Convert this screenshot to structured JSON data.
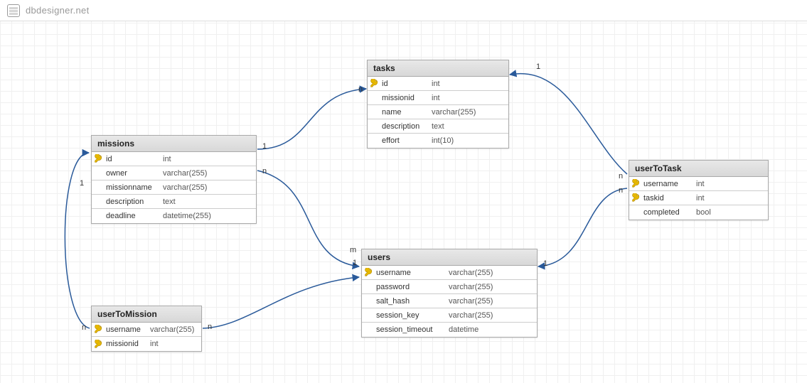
{
  "brand": "dbdesigner.net",
  "chart_data": {
    "type": "erd",
    "entities": [
      {
        "name": "missions",
        "columns": [
          {
            "name": "id",
            "type": "int",
            "pk": true
          },
          {
            "name": "owner",
            "type": "varchar(255)",
            "pk": false
          },
          {
            "name": "missionname",
            "type": "varchar(255)",
            "pk": false
          },
          {
            "name": "description",
            "type": "text",
            "pk": false
          },
          {
            "name": "deadline",
            "type": "datetime(255)",
            "pk": false
          }
        ]
      },
      {
        "name": "tasks",
        "columns": [
          {
            "name": "id",
            "type": "int",
            "pk": true
          },
          {
            "name": "missionid",
            "type": "int",
            "pk": false
          },
          {
            "name": "name",
            "type": "varchar(255)",
            "pk": false
          },
          {
            "name": "description",
            "type": "text",
            "pk": false
          },
          {
            "name": "effort",
            "type": "int(10)",
            "pk": false
          }
        ]
      },
      {
        "name": "users",
        "columns": [
          {
            "name": "username",
            "type": "varchar(255)",
            "pk": true
          },
          {
            "name": "password",
            "type": "varchar(255)",
            "pk": false
          },
          {
            "name": "salt_hash",
            "type": "varchar(255)",
            "pk": false
          },
          {
            "name": "session_key",
            "type": "varchar(255)",
            "pk": false
          },
          {
            "name": "session_timeout",
            "type": "datetime",
            "pk": false
          }
        ]
      },
      {
        "name": "userToMission",
        "columns": [
          {
            "name": "username",
            "type": "varchar(255)",
            "pk": true
          },
          {
            "name": "missionid",
            "type": "int",
            "pk": true
          }
        ]
      },
      {
        "name": "userToTask",
        "columns": [
          {
            "name": "username",
            "type": "int",
            "pk": true
          },
          {
            "name": "taskid",
            "type": "int",
            "pk": true
          },
          {
            "name": "completed",
            "type": "bool",
            "pk": false
          }
        ]
      }
    ],
    "relationships": [
      {
        "from": "missions",
        "to": "userToMission",
        "labels": [
          "1",
          "n"
        ]
      },
      {
        "from": "missions",
        "to": "tasks",
        "labels": [
          "1",
          "n"
        ]
      },
      {
        "from": "missions",
        "to": "users",
        "labels": [
          "n",
          "m",
          "1"
        ]
      },
      {
        "from": "users",
        "to": "userToMission",
        "labels": [
          "1",
          "n"
        ]
      },
      {
        "from": "users",
        "to": "userToTask",
        "labels": [
          "1",
          "n"
        ]
      },
      {
        "from": "tasks",
        "to": "userToTask",
        "labels": [
          "1",
          "n"
        ]
      }
    ]
  },
  "tables": {
    "missions": {
      "title": "missions",
      "cols": [
        {
          "pk": true,
          "name": "id",
          "type": "int"
        },
        {
          "pk": false,
          "name": "owner",
          "type": "varchar(255)"
        },
        {
          "pk": false,
          "name": "missionname",
          "type": "varchar(255)"
        },
        {
          "pk": false,
          "name": "description",
          "type": "text"
        },
        {
          "pk": false,
          "name": "deadline",
          "type": "datetime(255)"
        }
      ]
    },
    "tasks": {
      "title": "tasks",
      "cols": [
        {
          "pk": true,
          "name": "id",
          "type": "int"
        },
        {
          "pk": false,
          "name": "missionid",
          "type": "int"
        },
        {
          "pk": false,
          "name": "name",
          "type": "varchar(255)"
        },
        {
          "pk": false,
          "name": "description",
          "type": "text"
        },
        {
          "pk": false,
          "name": "effort",
          "type": "int(10)"
        }
      ]
    },
    "users": {
      "title": "users",
      "cols": [
        {
          "pk": true,
          "name": "username",
          "type": "varchar(255)"
        },
        {
          "pk": false,
          "name": "password",
          "type": "varchar(255)"
        },
        {
          "pk": false,
          "name": "salt_hash",
          "type": "varchar(255)"
        },
        {
          "pk": false,
          "name": "session_key",
          "type": "varchar(255)"
        },
        {
          "pk": false,
          "name": "session_timeout",
          "type": "datetime"
        }
      ]
    },
    "userToMission": {
      "title": "userToMission",
      "cols": [
        {
          "pk": true,
          "name": "username",
          "type": "varchar(255)"
        },
        {
          "pk": true,
          "name": "missionid",
          "type": "int"
        }
      ]
    },
    "userToTask": {
      "title": "userToTask",
      "cols": [
        {
          "pk": true,
          "name": "username",
          "type": "int"
        },
        {
          "pk": true,
          "name": "taskid",
          "type": "int"
        },
        {
          "pk": false,
          "name": "completed",
          "type": "bool"
        }
      ]
    }
  },
  "cardinality": {
    "l1": "1",
    "l2": "n",
    "l3": "1",
    "l4": "n",
    "l5": "n",
    "l6": "m",
    "l7": "1",
    "l8": "n",
    "l9": "1",
    "l10": "n",
    "l11": "1",
    "l12": "n"
  }
}
